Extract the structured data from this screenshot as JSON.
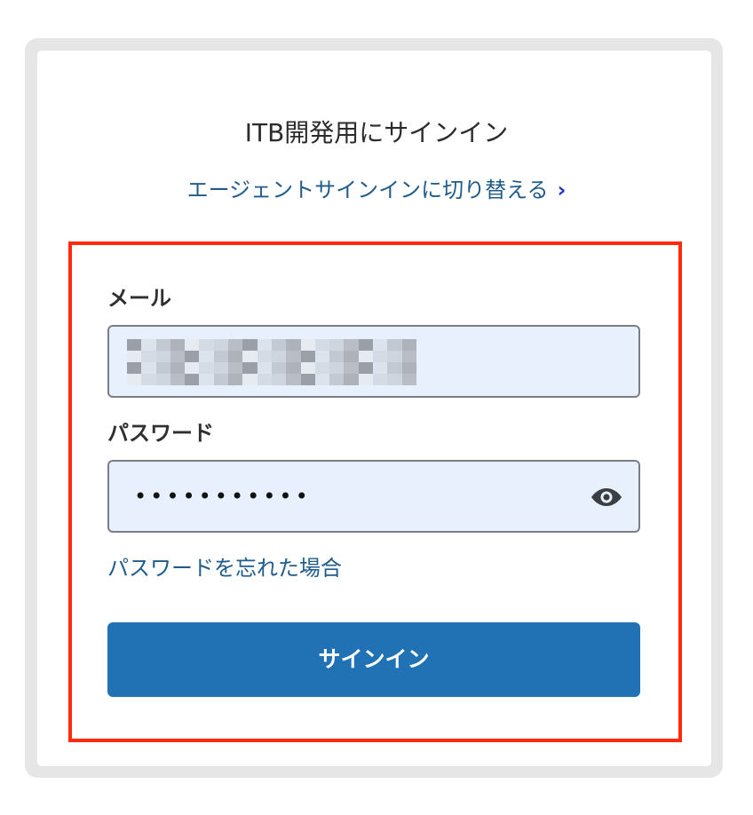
{
  "header": {
    "title": "ITB開発用にサインイン",
    "switch_link": "エージェントサインインに切り替える",
    "switch_icon": "chevron-right-icon"
  },
  "form": {
    "email_label": "メール",
    "email_value_obscured": true,
    "password_label": "パスワード",
    "password_value": "•••••••••••",
    "password_toggle_icon": "eye-icon",
    "forgot_link": "パスワードを忘れた場合",
    "submit_label": "サインイン"
  },
  "colors": {
    "accent": "#2072b5",
    "link": "#1f5c8c",
    "input_bg": "#e8f0fe",
    "highlight_border": "#ff2a0e"
  }
}
